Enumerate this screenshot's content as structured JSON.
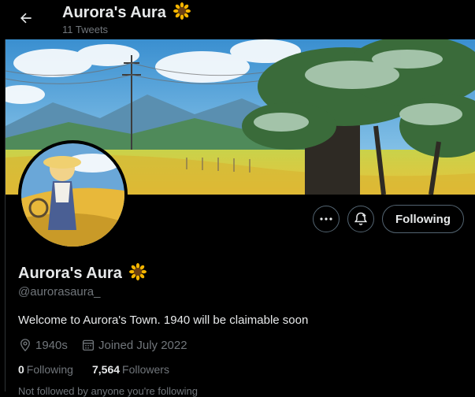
{
  "header": {
    "title": "Aurora's Aura",
    "tweet_count": "11 Tweets",
    "back_icon": "arrow-left-icon"
  },
  "profile": {
    "name": "Aurora's Aura",
    "name_emoji": "sunflower-icon",
    "handle": "@aurorasaura_",
    "bio": "Welcome to Aurora's Town. 1940 will be claimable soon",
    "location": "1940s",
    "joined": "Joined July 2022",
    "following_count": "0",
    "following_label": "Following",
    "followers_count": "7,564",
    "followers_label": "Followers",
    "followed_by_note": "Not followed by anyone you're following"
  },
  "actions": {
    "more_icon": "more-icon",
    "notify_icon": "bell-plus-icon",
    "following_button": "Following"
  },
  "colors": {
    "background": "#000000",
    "text_primary": "#e7e9ea",
    "text_secondary": "#71767b",
    "border": "#536471"
  }
}
